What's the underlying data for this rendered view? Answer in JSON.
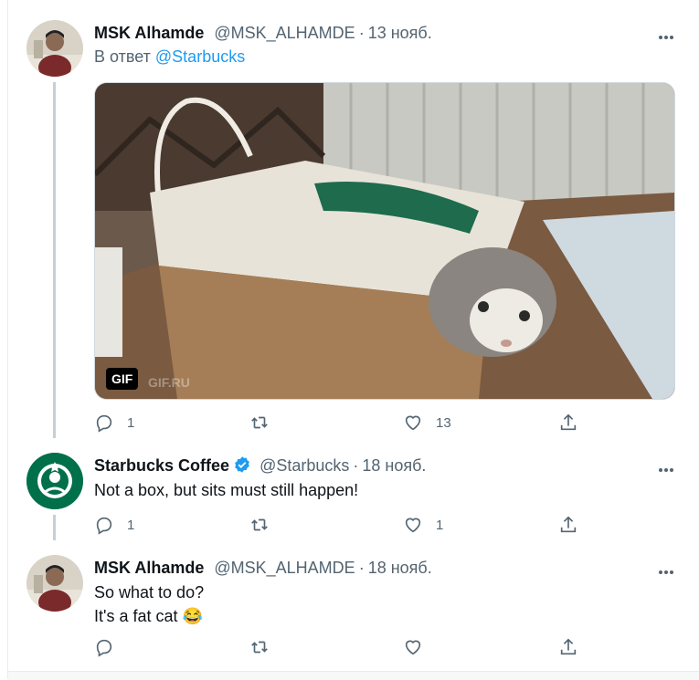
{
  "tweets": [
    {
      "name": "MSK Alhamde",
      "handle": "@MSK_ALHAMDE",
      "date": "13 нояб.",
      "reply_prefix": "В ответ",
      "reply_to": "@Starbucks",
      "media_badge": "GIF",
      "media_watermark": "GIF.RU",
      "actions": {
        "reply_count": "1",
        "retweet_count": "",
        "like_count": "13"
      }
    },
    {
      "name": "Starbucks Coffee",
      "handle": "@Starbucks",
      "date": "18 нояб.",
      "text": "Not a box, but sits must still happen!",
      "actions": {
        "reply_count": "1",
        "retweet_count": "",
        "like_count": "1"
      }
    },
    {
      "name": "MSK Alhamde",
      "handle": "@MSK_ALHAMDE",
      "date": "18 нояб.",
      "text_line1": "So what to do?",
      "text_line2": "It's a fat cat 😂",
      "actions": {
        "reply_count": "",
        "retweet_count": "",
        "like_count": ""
      }
    }
  ],
  "colors": {
    "link": "#1d9bf0",
    "secondary": "#536471",
    "thread_line": "#c4cfd6",
    "starbucks_green": "#00704a"
  },
  "icons": [
    "reply-icon",
    "retweet-icon",
    "like-icon",
    "share-icon",
    "more-icon",
    "verified-badge-icon"
  ]
}
